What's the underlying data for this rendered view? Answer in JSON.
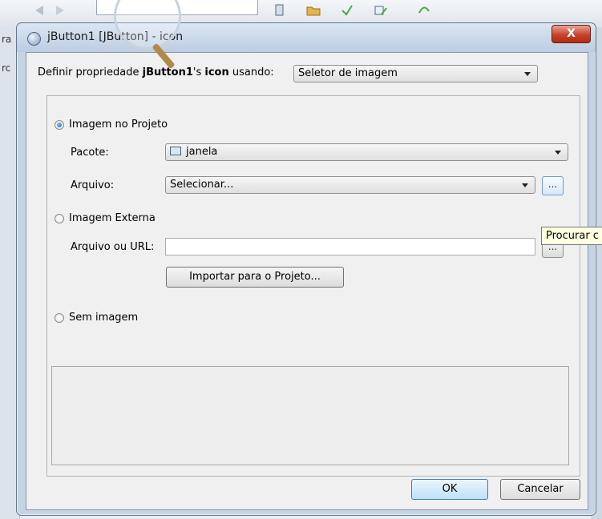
{
  "window": {
    "title": "jButton1 [JButton] - icon",
    "close_glyph": "X"
  },
  "property_row": {
    "prefix": "Definir propriedade ",
    "component": "jButton1",
    "possessive": "'s ",
    "property": "icon",
    "suffix": " usando:",
    "editor_selected": "Seletor de imagem"
  },
  "image_in_project": {
    "label": "Imagem no Projeto",
    "selected": true,
    "package_label": "Pacote:",
    "package_value": "janela",
    "file_label": "Arquivo:",
    "file_value": "Selecionar...",
    "browse_label": "..."
  },
  "external_image": {
    "label": "Imagem Externa",
    "selected": false,
    "file_url_label": "Arquivo ou URL:",
    "file_url_value": "",
    "browse_label": "...",
    "import_button": "Importar para o Projeto..."
  },
  "no_image": {
    "label": "Sem imagem",
    "selected": false
  },
  "tooltip": {
    "text": "Procurar c"
  },
  "footer": {
    "ok_label": "OK",
    "cancel_label": "Cancelar"
  },
  "background": {
    "left_labels": [
      "ra",
      "rc"
    ]
  },
  "colors": {
    "accent": "#3c7fb1",
    "close_button": "#c7432c",
    "tooltip_bg": "#ffffe1"
  }
}
